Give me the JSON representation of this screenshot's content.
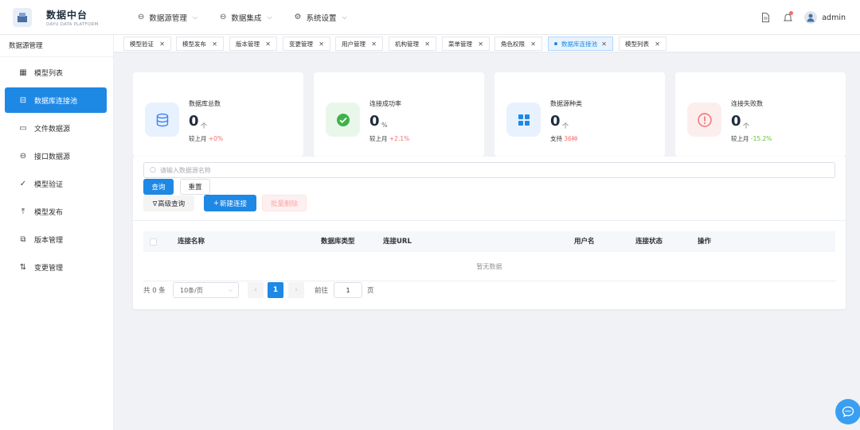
{
  "header": {
    "logo_title": "数据中台",
    "logo_subtitle": "DAYU DATA PLATFORM",
    "nav": [
      {
        "label": "数据源管理",
        "icon": "link-icon"
      },
      {
        "label": "数据集成",
        "icon": "link-icon"
      },
      {
        "label": "系统设置",
        "icon": "gear-icon"
      }
    ],
    "username": "admin",
    "accent": "#1e88e5"
  },
  "sidebar": {
    "title": "数据源管理",
    "items": [
      {
        "label": "模型列表",
        "icon": "grid-icon"
      },
      {
        "label": "数据库连接池",
        "icon": "database-icon"
      },
      {
        "label": "文件数据源",
        "icon": "folder-icon"
      },
      {
        "label": "接口数据源",
        "icon": "link-icon"
      },
      {
        "label": "模型验证",
        "icon": "check-icon"
      },
      {
        "label": "模型发布",
        "icon": "upload-icon"
      },
      {
        "label": "版本管理",
        "icon": "copy-icon"
      },
      {
        "label": "变更管理",
        "icon": "swap-icon"
      }
    ],
    "active_index": 1
  },
  "tabs": [
    {
      "label": "模型验证"
    },
    {
      "label": "模型发布"
    },
    {
      "label": "版本管理"
    },
    {
      "label": "变更管理"
    },
    {
      "label": "用户管理"
    },
    {
      "label": "机构管理"
    },
    {
      "label": "菜单管理"
    },
    {
      "label": "角色权限"
    },
    {
      "label": "数据库连接池"
    },
    {
      "label": "模型列表"
    }
  ],
  "stats": [
    {
      "label": "数据库总数",
      "value": "0",
      "unit": "个",
      "sub_prefix": "较上月",
      "sub_value": "+0%",
      "sub_color": "#f56c6c",
      "icon": "database-icon",
      "icon_color": "#3b82f6",
      "icon_bg": "#e8f1fe"
    },
    {
      "label": "连接成功率",
      "value": "0",
      "unit": "%",
      "sub_prefix": "较上月",
      "sub_value": "+2.1%",
      "sub_color": "#f56c6c",
      "icon": "check-circle-icon",
      "icon_color": "#3bb34a",
      "icon_bg": "#e9f7ea"
    },
    {
      "label": "数据源种类",
      "value": "0",
      "unit": "个",
      "sub_prefix": "支持",
      "sub_value": "36种",
      "sub_color": "#f56c6c",
      "icon": "apps-icon",
      "icon_color": "#1e88e5",
      "icon_bg": "#e8f1fe"
    },
    {
      "label": "连接失败数",
      "value": "0",
      "unit": "个",
      "sub_prefix": "较上月",
      "sub_value": "-15.2%",
      "sub_color": "#67c23a",
      "icon": "warning-circle-icon",
      "icon_color": "#f56c6c",
      "icon_bg": "#fdeeee"
    }
  ],
  "search": {
    "placeholder": "请输入数据源名称"
  },
  "buttons": {
    "query": "查询",
    "reset": "重置",
    "advanced": "高级查询",
    "new_connection": "新建连接",
    "batch_delete": "批量删除"
  },
  "table": {
    "columns": [
      "连接名称",
      "数据库类型",
      "连接URL",
      "用户名",
      "连接状态",
      "操作"
    ],
    "rows": [],
    "empty_text": "暂无数据"
  },
  "pagination": {
    "total_text": "共 0 条",
    "page_size": "10条/页",
    "current_page": "1",
    "goto_prefix": "前往",
    "goto_value": "1",
    "goto_suffix": "页"
  }
}
